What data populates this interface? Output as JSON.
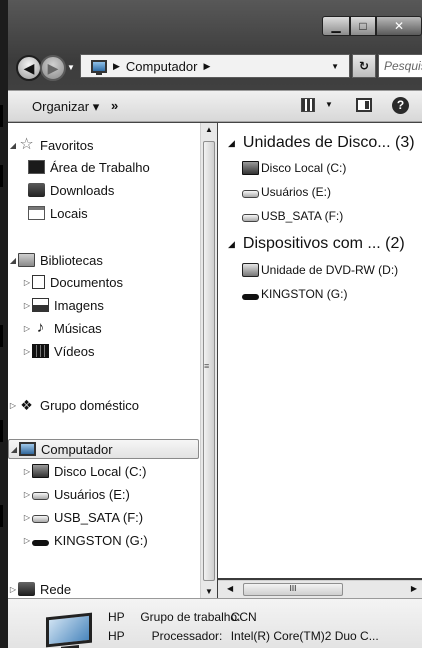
{
  "window": {
    "caption_buttons": {
      "minimize": "▁",
      "maximize": "□",
      "close": "✕"
    }
  },
  "address_bar": {
    "segments": [
      "Computador"
    ],
    "search_placeholder": "Pesquisa"
  },
  "toolbar": {
    "organize_label": "Organizar ▾",
    "more_label": "»"
  },
  "nav_pane": {
    "favorites": {
      "label": "Favoritos",
      "items": [
        "Área de Trabalho",
        "Downloads",
        "Locais"
      ]
    },
    "libraries": {
      "label": "Bibliotecas",
      "items": [
        "Documentos",
        "Imagens",
        "Músicas",
        "Vídeos"
      ]
    },
    "homegroup": {
      "label": "Grupo doméstico"
    },
    "computer": {
      "label": "Computador",
      "items": [
        "Disco Local (C:)",
        "Usuários (E:)",
        "USB_SATA (F:)",
        "KINGSTON (G:)"
      ]
    },
    "network": {
      "label": "Rede"
    }
  },
  "content": {
    "groups": [
      {
        "title": "Unidades de Disco... (3)",
        "items": [
          "Disco Local (C:)",
          "Usuários (E:)",
          "USB_SATA (F:)"
        ]
      },
      {
        "title": "Dispositivos com ... (2)",
        "items": [
          "Unidade de DVD-RW (D:)",
          "KINGSTON (G:)"
        ]
      }
    ],
    "hscroll_grip": "III"
  },
  "details": {
    "rows": [
      {
        "name": "HP",
        "key": "Grupo de trabalho:",
        "value": "CCN"
      },
      {
        "name": "HP",
        "key": "Processador:",
        "value": "Intel(R) Core(TM)2 Duo C..."
      }
    ]
  },
  "icons": [
    "back-icon",
    "forward-icon",
    "computer-icon",
    "refresh-icon",
    "views-icon",
    "preview-pane-icon",
    "help-icon",
    "star-icon",
    "desktop-icon",
    "downloads-icon",
    "places-icon",
    "library-icon",
    "document-icon",
    "image-icon",
    "music-icon",
    "video-icon",
    "homegroup-icon",
    "hard-drive-icon",
    "dvd-drive-icon",
    "usb-drive-icon",
    "network-icon"
  ]
}
